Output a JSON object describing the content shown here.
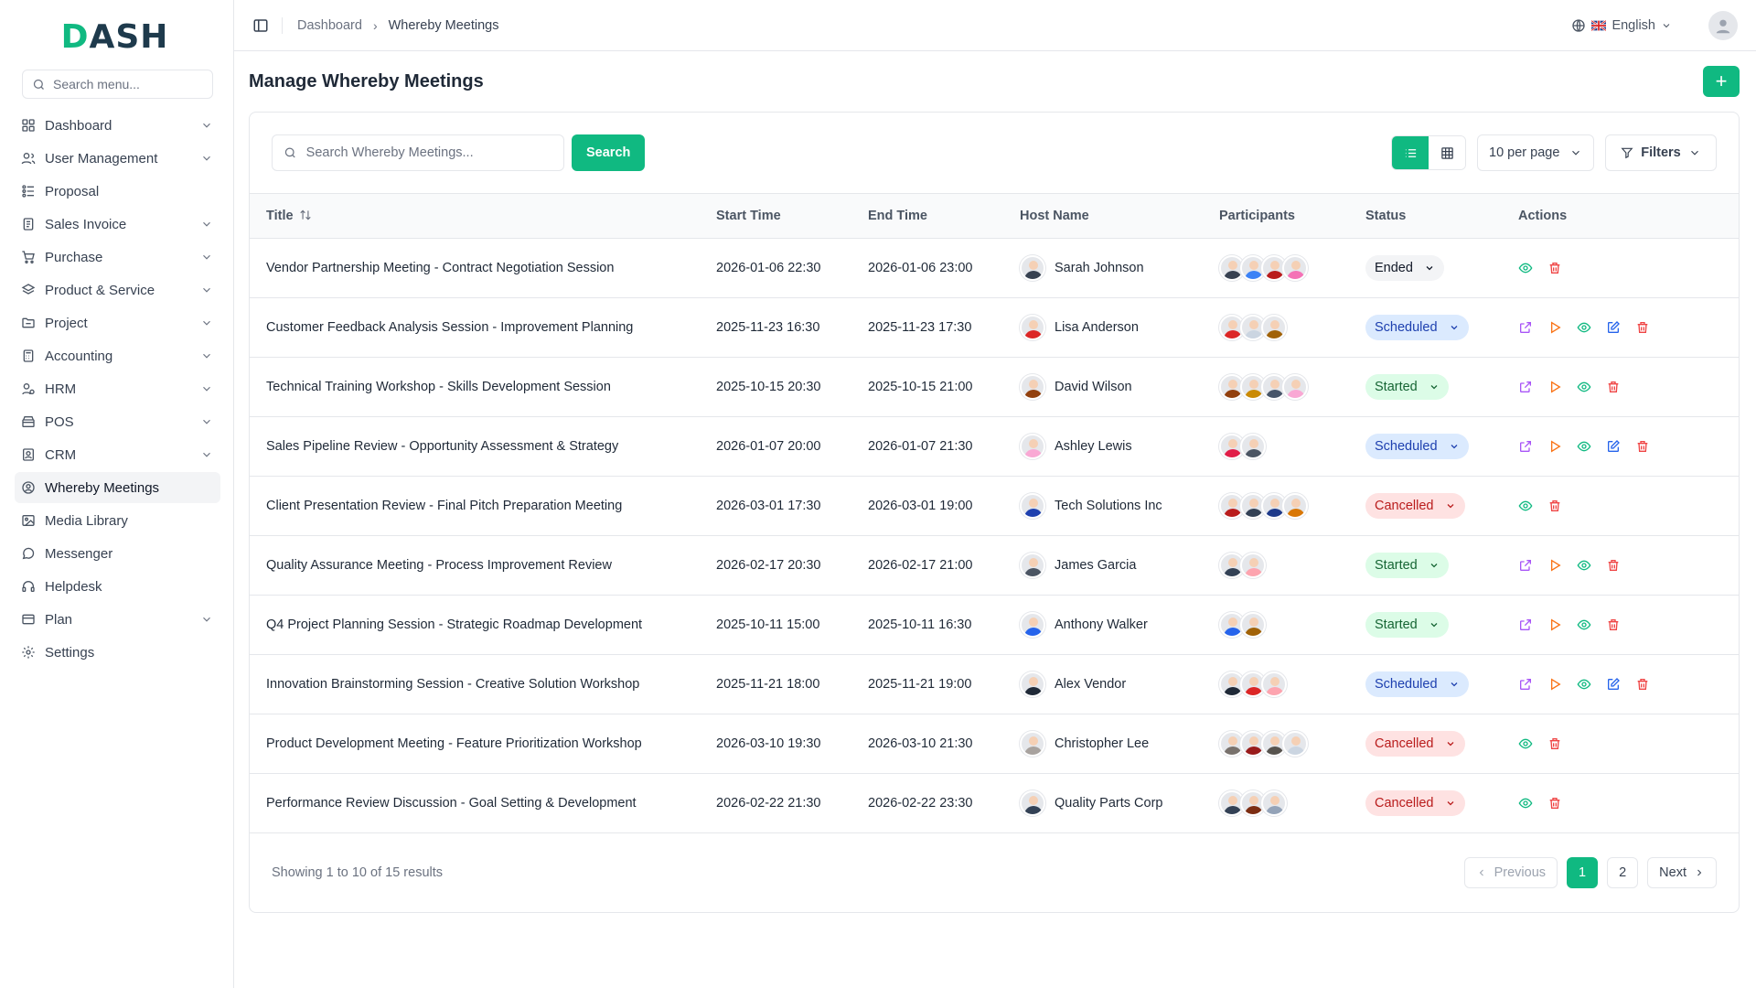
{
  "brand": {
    "logo_left": "D",
    "logo_right": "ASH"
  },
  "sidebar": {
    "search_placeholder": "Search menu...",
    "items": [
      {
        "label": "Dashboard",
        "icon": "grid-icon",
        "chevron": true
      },
      {
        "label": "User Management",
        "icon": "users-icon",
        "chevron": true
      },
      {
        "label": "Proposal",
        "icon": "proposal-icon",
        "chevron": false
      },
      {
        "label": "Sales Invoice",
        "icon": "invoice-icon",
        "chevron": true
      },
      {
        "label": "Purchase",
        "icon": "cart-icon",
        "chevron": true
      },
      {
        "label": "Product & Service",
        "icon": "layers-icon",
        "chevron": true
      },
      {
        "label": "Project",
        "icon": "folder-icon",
        "chevron": true
      },
      {
        "label": "Accounting",
        "icon": "calculator-icon",
        "chevron": true
      },
      {
        "label": "HRM",
        "icon": "hrm-icon",
        "chevron": true
      },
      {
        "label": "POS",
        "icon": "pos-icon",
        "chevron": true
      },
      {
        "label": "CRM",
        "icon": "crm-icon",
        "chevron": true
      },
      {
        "label": "Whereby Meetings",
        "icon": "meeting-icon",
        "chevron": false,
        "active": true
      },
      {
        "label": "Media Library",
        "icon": "image-icon",
        "chevron": false
      },
      {
        "label": "Messenger",
        "icon": "chat-icon",
        "chevron": false
      },
      {
        "label": "Helpdesk",
        "icon": "headset-icon",
        "chevron": false
      },
      {
        "label": "Plan",
        "icon": "plan-icon",
        "chevron": true
      },
      {
        "label": "Settings",
        "icon": "gear-icon",
        "chevron": false
      }
    ]
  },
  "topbar": {
    "breadcrumb": [
      "Dashboard",
      "Whereby Meetings"
    ],
    "language": "English"
  },
  "page": {
    "title": "Manage Whereby Meetings",
    "search_placeholder": "Search Whereby Meetings...",
    "search_button": "Search",
    "per_page": "10 per page",
    "filters": "Filters"
  },
  "table": {
    "headers": [
      "Title",
      "Start Time",
      "End Time",
      "Host Name",
      "Participants",
      "Status",
      "Actions"
    ],
    "rows": [
      {
        "title": "Vendor Partnership Meeting - Contract Negotiation Session",
        "start": "2026-01-06 22:30",
        "end": "2026-01-06 23:00",
        "host": "Sarah Johnson",
        "host_color": "#374151",
        "participants": [
          "#374151",
          "#3b82f6",
          "#b91c1c",
          "#f472b6"
        ],
        "status": "Ended",
        "status_kind": "ended",
        "actions": [
          "view",
          "delete"
        ]
      },
      {
        "title": "Customer Feedback Analysis Session - Improvement Planning",
        "start": "2025-11-23 16:30",
        "end": "2025-11-23 17:30",
        "host": "Lisa Anderson",
        "host_color": "#dc2626",
        "participants": [
          "#dc2626",
          "#cbd5e1",
          "#a16207"
        ],
        "status": "Scheduled",
        "status_kind": "scheduled",
        "actions": [
          "external",
          "play",
          "view",
          "edit",
          "delete"
        ]
      },
      {
        "title": "Technical Training Workshop - Skills Development Session",
        "start": "2025-10-15 20:30",
        "end": "2025-10-15 21:00",
        "host": "David Wilson",
        "host_color": "#92400e",
        "participants": [
          "#92400e",
          "#ca8a04",
          "#475569",
          "#f9a8d4"
        ],
        "status": "Started",
        "status_kind": "started",
        "actions": [
          "external",
          "play",
          "view",
          "delete"
        ]
      },
      {
        "title": "Sales Pipeline Review - Opportunity Assessment & Strategy",
        "start": "2026-01-07 20:00",
        "end": "2026-01-07 21:30",
        "host": "Ashley Lewis",
        "host_color": "#f9a8d4",
        "participants": [
          "#e11d48",
          "#4b5563"
        ],
        "status": "Scheduled",
        "status_kind": "scheduled",
        "actions": [
          "external",
          "play",
          "view",
          "edit",
          "delete"
        ]
      },
      {
        "title": "Client Presentation Review - Final Pitch Preparation Meeting",
        "start": "2026-03-01 17:30",
        "end": "2026-03-01 19:00",
        "host": "Tech Solutions Inc",
        "host_color": "#1e40af",
        "participants": [
          "#b91c1c",
          "#334155",
          "#1e3a8a",
          "#d97706"
        ],
        "status": "Cancelled",
        "status_kind": "cancelled",
        "actions": [
          "view",
          "delete"
        ]
      },
      {
        "title": "Quality Assurance Meeting - Process Improvement Review",
        "start": "2026-02-17 20:30",
        "end": "2026-02-17 21:00",
        "host": "James Garcia",
        "host_color": "#4b5563",
        "participants": [
          "#334155",
          "#fda4af"
        ],
        "status": "Started",
        "status_kind": "started",
        "actions": [
          "external",
          "play",
          "view",
          "delete"
        ]
      },
      {
        "title": "Q4 Project Planning Session - Strategic Roadmap Development",
        "start": "2025-10-11 15:00",
        "end": "2025-10-11 16:30",
        "host": "Anthony Walker",
        "host_color": "#2563eb",
        "participants": [
          "#2563eb",
          "#a16207"
        ],
        "status": "Started",
        "status_kind": "started",
        "actions": [
          "external",
          "play",
          "view",
          "delete"
        ]
      },
      {
        "title": "Innovation Brainstorming Session - Creative Solution Workshop",
        "start": "2025-11-21 18:00",
        "end": "2025-11-21 19:00",
        "host": "Alex Vendor",
        "host_color": "#1f2937",
        "participants": [
          "#1f2937",
          "#dc2626",
          "#fda4af"
        ],
        "status": "Scheduled",
        "status_kind": "scheduled",
        "actions": [
          "external",
          "play",
          "view",
          "edit",
          "delete"
        ]
      },
      {
        "title": "Product Development Meeting - Feature Prioritization Workshop",
        "start": "2026-03-10 19:30",
        "end": "2026-03-10 21:30",
        "host": "Christopher Lee",
        "host_color": "#a8a29e",
        "participants": [
          "#78716c",
          "#991b1b",
          "#57534e",
          "#cbd5e1"
        ],
        "status": "Cancelled",
        "status_kind": "cancelled",
        "actions": [
          "view",
          "delete"
        ]
      },
      {
        "title": "Performance Review Discussion - Goal Setting & Development",
        "start": "2026-02-22 21:30",
        "end": "2026-02-22 23:30",
        "host": "Quality Parts Corp",
        "host_color": "#334155",
        "participants": [
          "#334155",
          "#7c2d12",
          "#94a3b8"
        ],
        "status": "Cancelled",
        "status_kind": "cancelled",
        "actions": [
          "view",
          "delete"
        ]
      }
    ]
  },
  "footer": {
    "showing": "Showing 1 to 10 of 15 results",
    "previous": "Previous",
    "pages": [
      "1",
      "2"
    ],
    "next": "Next"
  },
  "colors": {
    "accent": "#10b981"
  }
}
